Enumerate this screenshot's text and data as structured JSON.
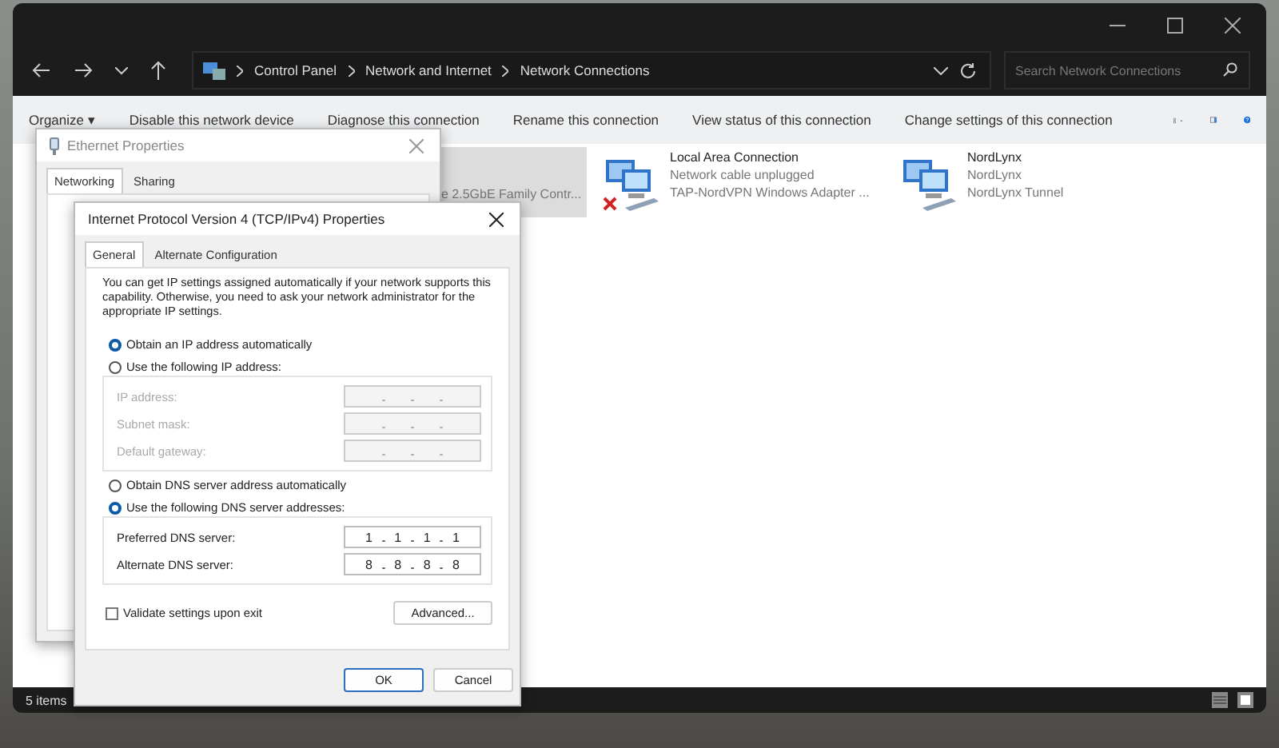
{
  "explorer": {
    "breadcrumbs": [
      "Control Panel",
      "Network and Internet",
      "Network Connections"
    ],
    "search": {
      "placeholder": "Search Network Connections"
    },
    "commands": [
      "Organize ▾",
      "Disable this network device",
      "Diagnose this connection",
      "Rename this connection",
      "View status of this connection",
      "Change settings of this connection"
    ],
    "connections": [
      {
        "lines": [
          "e 2.5GbE Family Contr..."
        ],
        "selected": true,
        "kind": "partial"
      },
      {
        "lines": [
          "Local Area Connection",
          "Network cable unplugged",
          "TAP-NordVPN Windows Adapter ..."
        ],
        "selected": false,
        "disconnected": true,
        "kind": "full"
      },
      {
        "lines": [
          "NordLynx",
          "NordLynx",
          "NordLynx Tunnel"
        ],
        "selected": false,
        "disconnected": false,
        "kind": "full"
      }
    ],
    "status": "5 items"
  },
  "ethernet_dialog": {
    "title": "Ethernet Properties",
    "tabs": [
      {
        "label": "Networking",
        "selected": true
      },
      {
        "label": "Sharing",
        "selected": false
      }
    ]
  },
  "ipv4_dialog": {
    "title": "Internet Protocol Version 4 (TCP/IPv4) Properties",
    "tabs": [
      {
        "label": "General",
        "selected": true
      },
      {
        "label": "Alternate Configuration",
        "selected": false
      }
    ],
    "intro": "You can get IP settings assigned automatically if your network supports this capability. Otherwise, you need to ask your network administrator for the appropriate IP settings.",
    "ip_options": [
      {
        "label": "Obtain an IP address automatically",
        "selected": true
      },
      {
        "label": "Use the following IP address:",
        "selected": false
      }
    ],
    "ip_fields": [
      {
        "label": "IP address:",
        "disabled": true
      },
      {
        "label": "Subnet mask:",
        "disabled": true
      },
      {
        "label": "Default gateway:",
        "disabled": true
      }
    ],
    "dns_options": [
      {
        "label": "Obtain DNS server address automatically",
        "selected": false
      },
      {
        "label": "Use the following DNS server addresses:",
        "selected": true
      }
    ],
    "dns_fields": [
      {
        "label": "Preferred DNS server:",
        "disabled": false,
        "octets": [
          "1",
          "1",
          "1",
          "1"
        ]
      },
      {
        "label": "Alternate DNS server:",
        "disabled": false,
        "octets": [
          "8",
          "8",
          "8",
          "8"
        ]
      }
    ],
    "validate": {
      "label": "Validate settings upon exit",
      "checked": false
    },
    "advanced_button": "Advanced...",
    "buttons": [
      "OK",
      "Cancel"
    ]
  }
}
